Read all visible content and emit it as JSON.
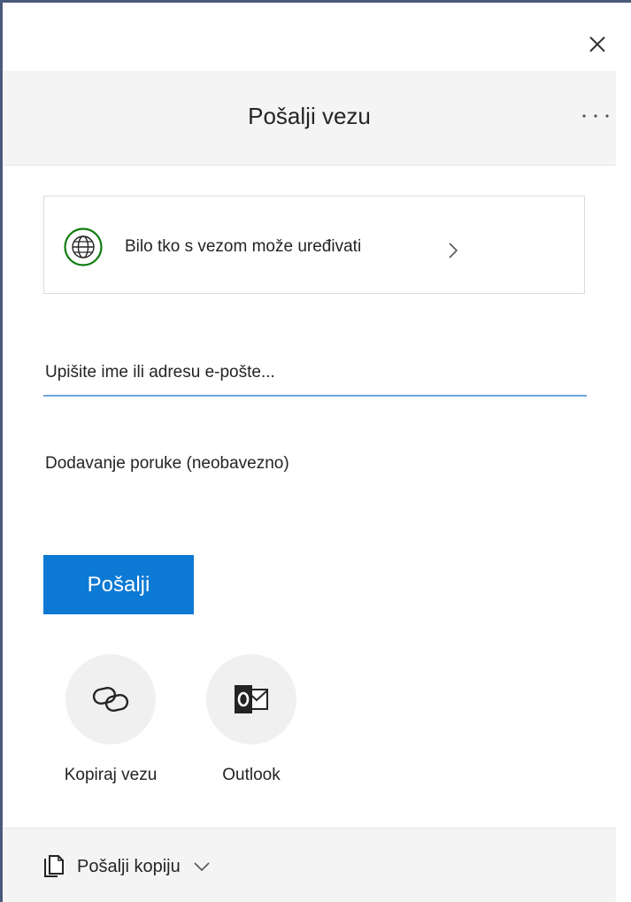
{
  "dialog": {
    "title": "Pošalji vezu",
    "close_icon": "close-icon",
    "more_icon": "more-options-icon"
  },
  "permission": {
    "icon": "globe-icon",
    "text": "Bilo tko s vezom može uređivati",
    "chevron_icon": "chevron-right-icon",
    "icon_color": "#107c10"
  },
  "recipient": {
    "placeholder": "Upišite ime ili adresu e-pošte..."
  },
  "message": {
    "placeholder": "Dodavanje poruke (neobavezno)"
  },
  "send_button": {
    "label": "Pošalji",
    "color": "#0c79d4"
  },
  "share_options": [
    {
      "label": "Kopiraj vezu",
      "icon": "link-icon"
    },
    {
      "label": "Outlook",
      "icon": "outlook-icon"
    }
  ],
  "footer": {
    "send_copy_label": "Pošalji kopiju",
    "copy_icon": "copy-icon",
    "chevron_icon": "chevron-down-icon"
  }
}
